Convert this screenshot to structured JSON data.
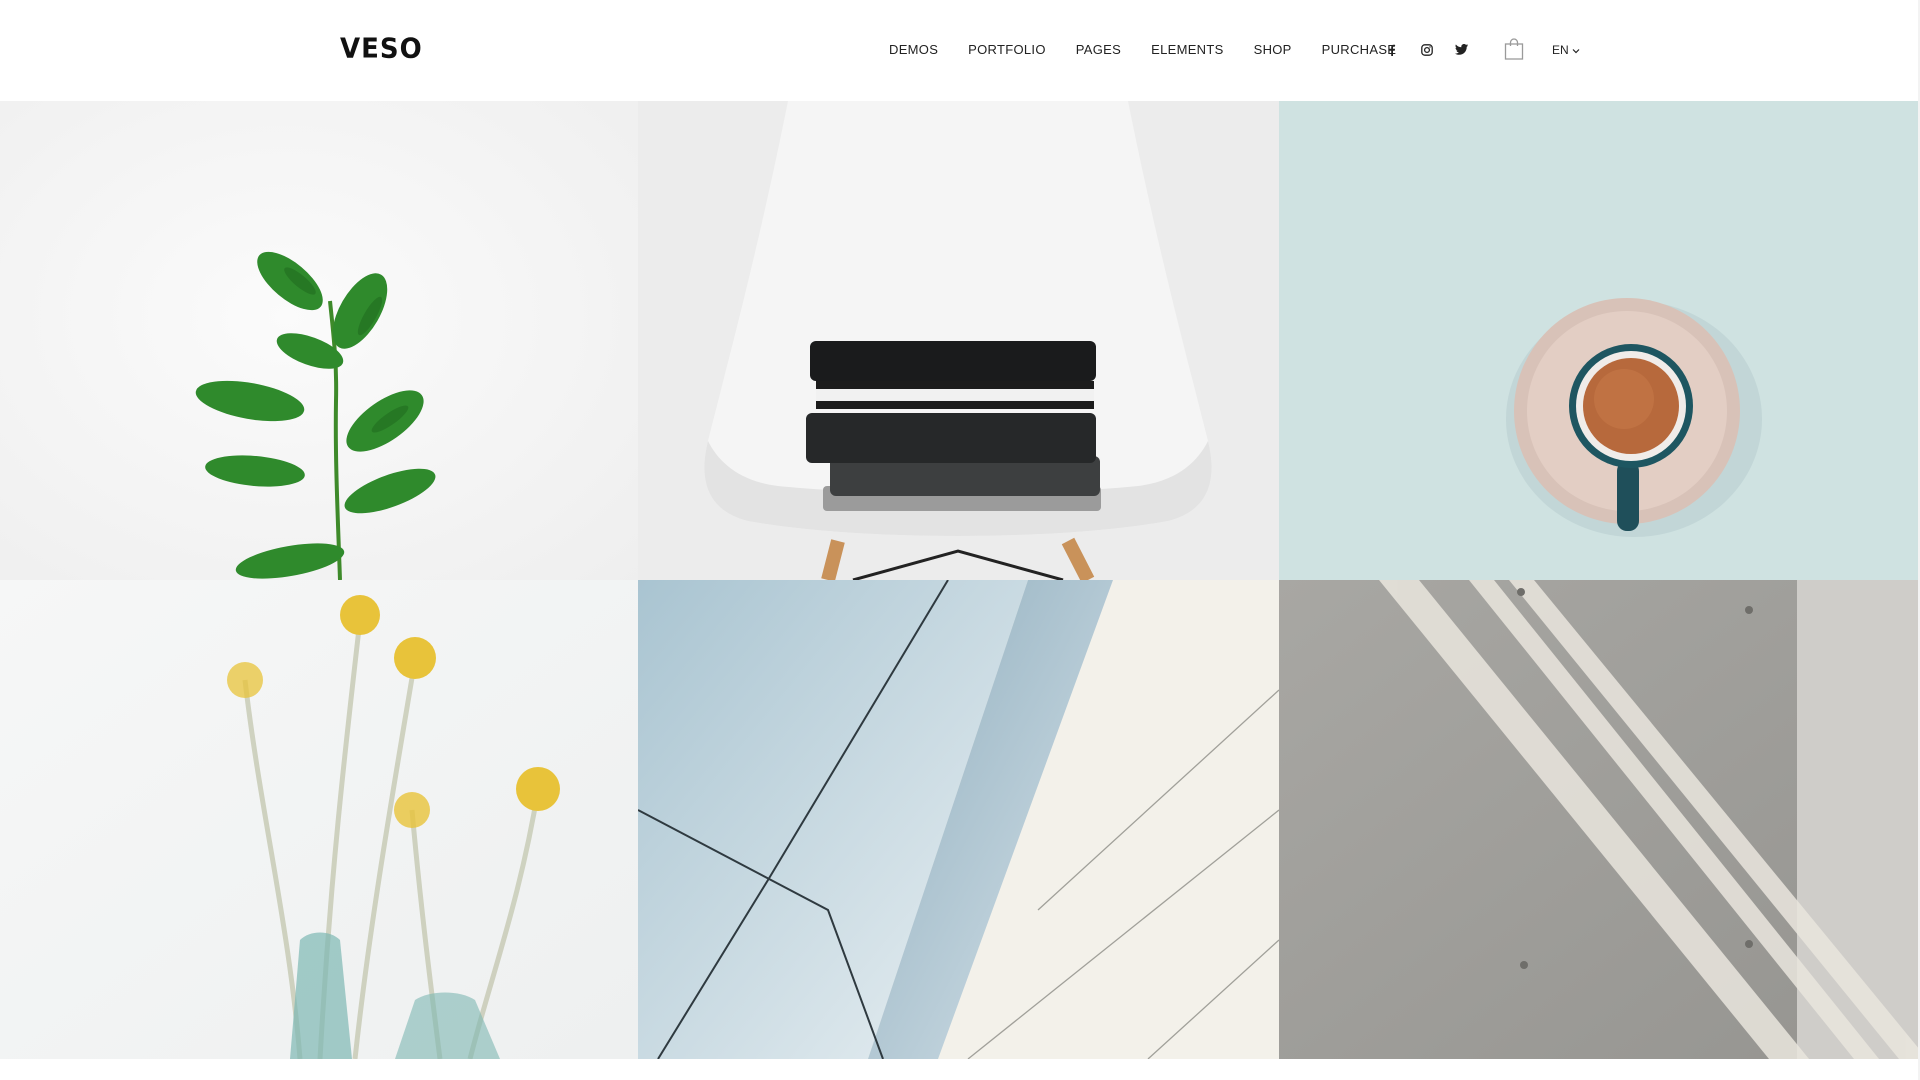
{
  "header": {
    "logo": "VESO",
    "nav": [
      "DEMOS",
      "PORTFOLIO",
      "PAGES",
      "ELEMENTS",
      "SHOP",
      "PURCHASE"
    ],
    "social_icons": [
      "facebook-icon",
      "instagram-icon",
      "twitter-icon"
    ],
    "cart_icon": "shopping-bag-icon",
    "language": "EN"
  },
  "colors": {
    "strip_left": "#f0c069",
    "strip_mid": "#e2a070",
    "strip_right": "#f07c8f",
    "text": "#222222"
  },
  "gallery": {
    "tiles": [
      {
        "subject": "green-plant"
      },
      {
        "subject": "folded-clothes-on-white-chair"
      },
      {
        "subject": "coffee-cup-on-saucer"
      },
      {
        "subject": "yellow-flowers-in-glass-vases"
      },
      {
        "subject": "abstract-architecture"
      },
      {
        "subject": "concrete-wall-with-shadows"
      }
    ]
  }
}
